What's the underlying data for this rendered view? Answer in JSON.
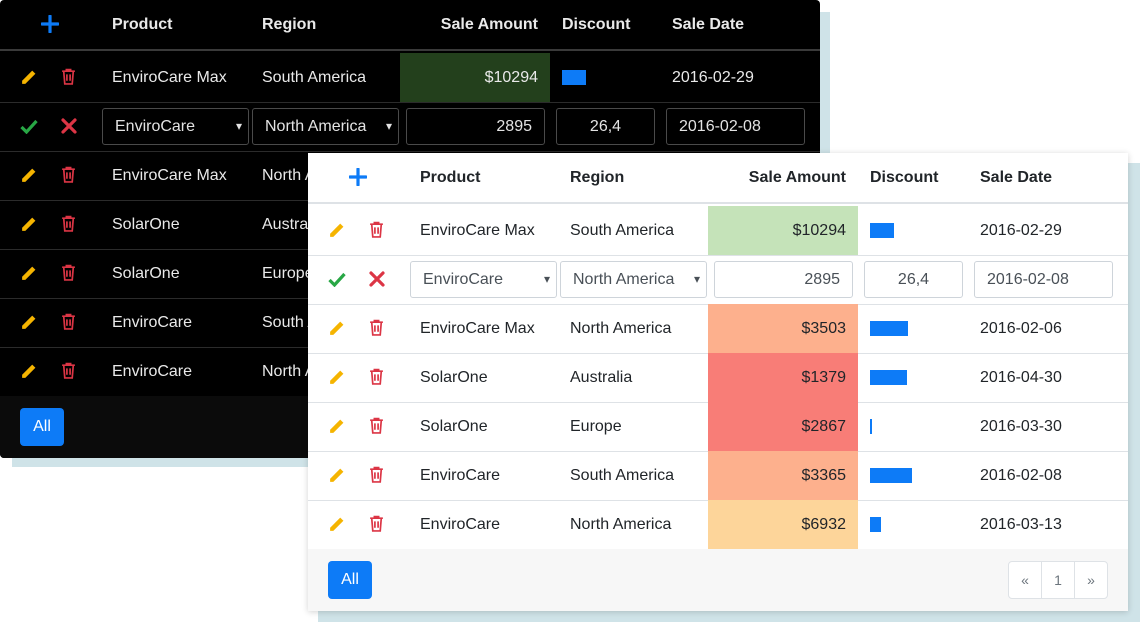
{
  "columns": {
    "product": "Product",
    "region": "Region",
    "amount": "Sale Amount",
    "discount": "Discount",
    "date": "Sale Date"
  },
  "dark_rows": [
    {
      "product": "EnviroCare Max",
      "region": "South America",
      "amount": "$10294",
      "date": "2016-02-29",
      "discount_ratio": 0.3
    },
    {
      "product": "EnviroCare Max",
      "region": "North America"
    },
    {
      "product": "SolarOne",
      "region": "Australia"
    },
    {
      "product": "SolarOne",
      "region": "Europe"
    },
    {
      "product": "EnviroCare",
      "region": "South America"
    },
    {
      "product": "EnviroCare",
      "region": "North America"
    }
  ],
  "light_rows": [
    {
      "product": "EnviroCare Max",
      "region": "South America",
      "amount": "$10294",
      "date": "2016-02-29",
      "discount_ratio": 0.3,
      "color": "#c5e3b9"
    },
    {
      "product": "EnviroCare Max",
      "region": "North America",
      "amount": "$3503",
      "date": "2016-02-06",
      "discount_ratio": 0.48,
      "color": "#fdb08d"
    },
    {
      "product": "SolarOne",
      "region": "Australia",
      "amount": "$1379",
      "date": "2016-04-30",
      "discount_ratio": 0.46,
      "color": "#f87d77"
    },
    {
      "product": "SolarOne",
      "region": "Europe",
      "amount": "$2867",
      "date": "2016-03-30",
      "discount_ratio": 0.03,
      "color": "#f87d77"
    },
    {
      "product": "EnviroCare",
      "region": "South America",
      "amount": "$3365",
      "date": "2016-02-08",
      "discount_ratio": 0.52,
      "color": "#fdb08d"
    },
    {
      "product": "EnviroCare",
      "region": "North America",
      "amount": "$6932",
      "date": "2016-03-13",
      "discount_ratio": 0.14,
      "color": "#fdd59a"
    }
  ],
  "edit_row": {
    "product": "EnviroCare",
    "region": "North America",
    "amount": "2895",
    "discount": "26,4",
    "date": "2016-02-08"
  },
  "footer": {
    "all_label": "All",
    "prev": "«",
    "page": "1",
    "next": "»"
  },
  "colors": {
    "accent": "#0d7bf7",
    "edit": "#f5b400",
    "delete": "#dc3545",
    "confirm": "#28a745",
    "bar": "#0d7bf7",
    "dark_amount_bg": "#23401c"
  }
}
